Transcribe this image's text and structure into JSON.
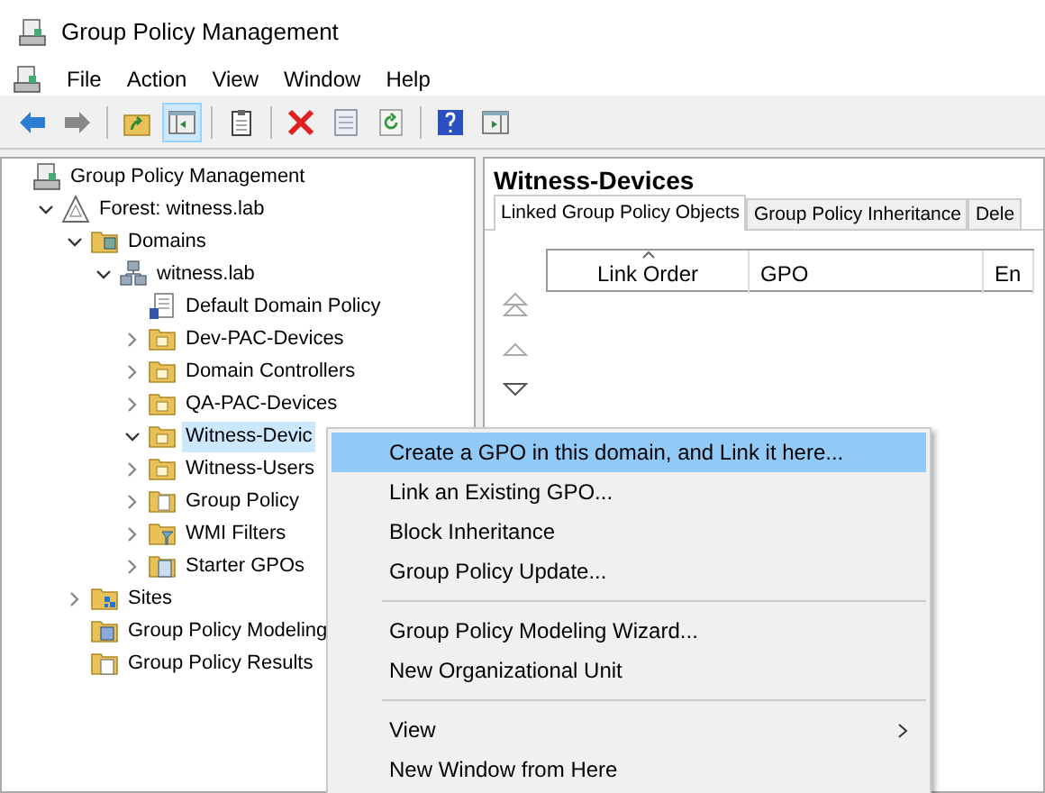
{
  "window": {
    "title": "Group Policy Management"
  },
  "menu_bar": [
    "File",
    "Action",
    "View",
    "Window",
    "Help"
  ],
  "toolbar": [
    {
      "kind": "back",
      "on": false
    },
    {
      "kind": "forward",
      "on": false
    },
    {
      "kind": "up",
      "on": false
    },
    {
      "kind": "tree",
      "on": true
    },
    {
      "kind": "clipboard",
      "on": false
    },
    {
      "kind": "delete",
      "on": false
    },
    {
      "kind": "properties",
      "on": false
    },
    {
      "kind": "refresh",
      "on": false
    },
    {
      "kind": "help",
      "on": false
    },
    {
      "kind": "pane",
      "on": false
    }
  ],
  "tree": [
    {
      "label": "Group Policy Management",
      "kind": "console",
      "selected": false,
      "children": [
        {
          "label": "Forest: witness.lab",
          "kind": "forest",
          "expanded": true,
          "selected": false,
          "children": [
            {
              "label": "Domains",
              "kind": "domains",
              "expanded": true,
              "selected": false,
              "children": [
                {
                  "label": "witness.lab",
                  "kind": "domain",
                  "expanded": true,
                  "selected": false,
                  "children": [
                    {
                      "label": "Default Domain Policy",
                      "kind": "policy",
                      "selected": false
                    },
                    {
                      "label": "Dev-PAC-Devices",
                      "kind": "ou",
                      "expanded": false,
                      "selected": false
                    },
                    {
                      "label": "Domain Controllers",
                      "kind": "ou",
                      "expanded": false,
                      "selected": false
                    },
                    {
                      "label": "QA-PAC-Devices",
                      "kind": "ou",
                      "expanded": false,
                      "selected": false
                    },
                    {
                      "label": "Witness-Devic",
                      "kind": "ou",
                      "expanded": true,
                      "selected": true
                    },
                    {
                      "label": "Witness-Users",
                      "kind": "ou",
                      "expanded": false,
                      "selected": false
                    },
                    {
                      "label": "Group Policy",
                      "kind": "gpo-folder",
                      "expanded": false,
                      "selected": false
                    },
                    {
                      "label": "WMI Filters",
                      "kind": "wmi",
                      "expanded": false,
                      "selected": false
                    },
                    {
                      "label": "Starter GPOs",
                      "kind": "starter",
                      "expanded": false,
                      "selected": false
                    }
                  ]
                }
              ]
            },
            {
              "label": "Sites",
              "kind": "sites",
              "expanded": false,
              "selected": false
            },
            {
              "label": "Group Policy Modeling",
              "kind": "modeling",
              "selected": false
            },
            {
              "label": "Group Policy Results",
              "kind": "results",
              "selected": false
            }
          ]
        }
      ]
    }
  ],
  "details": {
    "title": "Witness-Devices",
    "tabs": [
      {
        "label": "Linked Group Policy Objects",
        "selected": true
      },
      {
        "label": "Group Policy Inheritance",
        "selected": false
      },
      {
        "label": "Dele",
        "selected": false
      }
    ],
    "columns": [
      {
        "label": "Link Order",
        "sorted": true
      },
      {
        "label": "GPO",
        "sorted": false
      },
      {
        "label": "En",
        "sorted": false
      }
    ]
  },
  "context_menu": {
    "groups": [
      [
        {
          "label": "Create a GPO in this domain, and Link it here...",
          "selected": true,
          "submenu": false
        },
        {
          "label": "Link an Existing GPO...",
          "selected": false,
          "submenu": false
        },
        {
          "label": "Block Inheritance",
          "selected": false,
          "submenu": false
        },
        {
          "label": "Group Policy Update...",
          "selected": false,
          "submenu": false
        }
      ],
      [
        {
          "label": "Group Policy Modeling Wizard...",
          "selected": false,
          "submenu": false
        },
        {
          "label": "New Organizational Unit",
          "selected": false,
          "submenu": false
        }
      ],
      [
        {
          "label": "View",
          "selected": false,
          "submenu": true
        },
        {
          "label": "New Window from Here",
          "selected": false,
          "submenu": false
        }
      ]
    ]
  }
}
